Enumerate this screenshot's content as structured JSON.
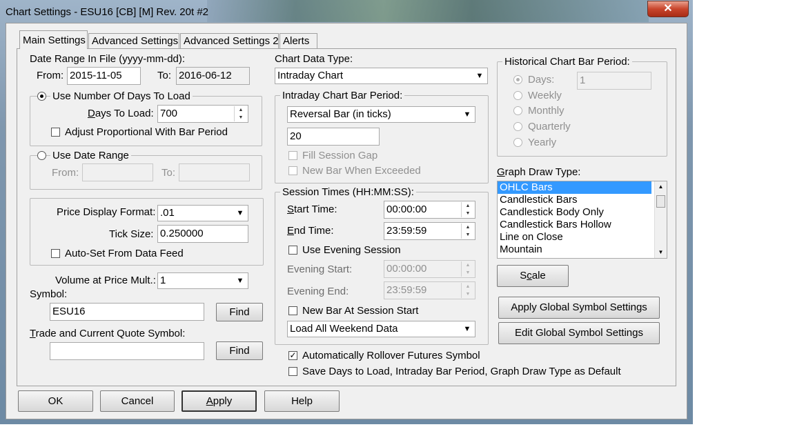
{
  "window": {
    "title": "Chart Settings - ESU16 [CB] [M]  Rev. 20t  #2",
    "close_glyph": "✕"
  },
  "tabs": [
    "Main Settings",
    "Advanced Settings",
    "Advanced Settings 2",
    "Alerts"
  ],
  "date_range": {
    "title": "Date Range In File (yyyy-mm-dd):",
    "from_label": "From:",
    "from_value": "2015-11-05",
    "to_label": "To:",
    "to_value": "2016-06-12"
  },
  "days_group": {
    "radio_label": "Use Number Of Days To Load",
    "days_label": "Days To Load:",
    "days_value": "700",
    "adjust_label": "Adjust Proportional With Bar Period"
  },
  "date_range_group": {
    "radio_label": "Use Date Range",
    "from_label": "From:",
    "to_label": "To:"
  },
  "price_group": {
    "format_label": "Price Display Format:",
    "format_value": ".01",
    "tick_label": "Tick Size:",
    "tick_value": "0.250000",
    "autoset_label": "Auto-Set From Data Feed"
  },
  "volume": {
    "label": "Volume at Price Mult.:",
    "value": "1"
  },
  "symbol": {
    "label": "Symbol:",
    "value": "ESU16",
    "find": "Find"
  },
  "trade_symbol": {
    "label": "Trade and Current Quote Symbol:",
    "value": "",
    "find": "Find"
  },
  "chart_type": {
    "label": "Chart Data Type:",
    "value": "Intraday Chart"
  },
  "intraday": {
    "title": "Intraday Chart Bar Period:",
    "type_value": "Reversal Bar (in ticks)",
    "period_value": "20",
    "fill_gap": "Fill Session Gap",
    "new_bar_exceeded": "New Bar When Exceeded"
  },
  "session": {
    "title": "Session Times (HH:MM:SS):",
    "start_label": "Start Time:",
    "start_value": "00:00:00",
    "end_label": "End Time:",
    "end_value": "23:59:59",
    "evening_label": "Use Evening Session",
    "evening_start_label": "Evening Start:",
    "evening_start_value": "00:00:00",
    "evening_end_label": "Evening End:",
    "evening_end_value": "23:59:59",
    "new_bar_label": "New Bar At Session Start",
    "weekend_value": "Load All Weekend Data"
  },
  "rollover_label": "Automatically Rollover Futures Symbol",
  "save_default_label": "Save Days to Load, Intraday Bar Period, Graph Draw Type as Default",
  "historical": {
    "title": "Historical Chart Bar Period:",
    "days": "Days:",
    "days_value": "1",
    "weekly": "Weekly",
    "monthly": "Monthly",
    "quarterly": "Quarterly",
    "yearly": "Yearly"
  },
  "graph_draw": {
    "label": "Graph Draw Type:",
    "items": [
      "OHLC Bars",
      "Candlestick Bars",
      "Candlestick Body Only",
      "Candlestick Bars Hollow",
      "Line on Close",
      "Mountain"
    ]
  },
  "buttons": {
    "scale": "Scale",
    "apply_global": "Apply Global Symbol Settings",
    "edit_global": "Edit Global Symbol Settings",
    "ok": "OK",
    "cancel": "Cancel",
    "apply": "Apply",
    "help": "Help"
  }
}
